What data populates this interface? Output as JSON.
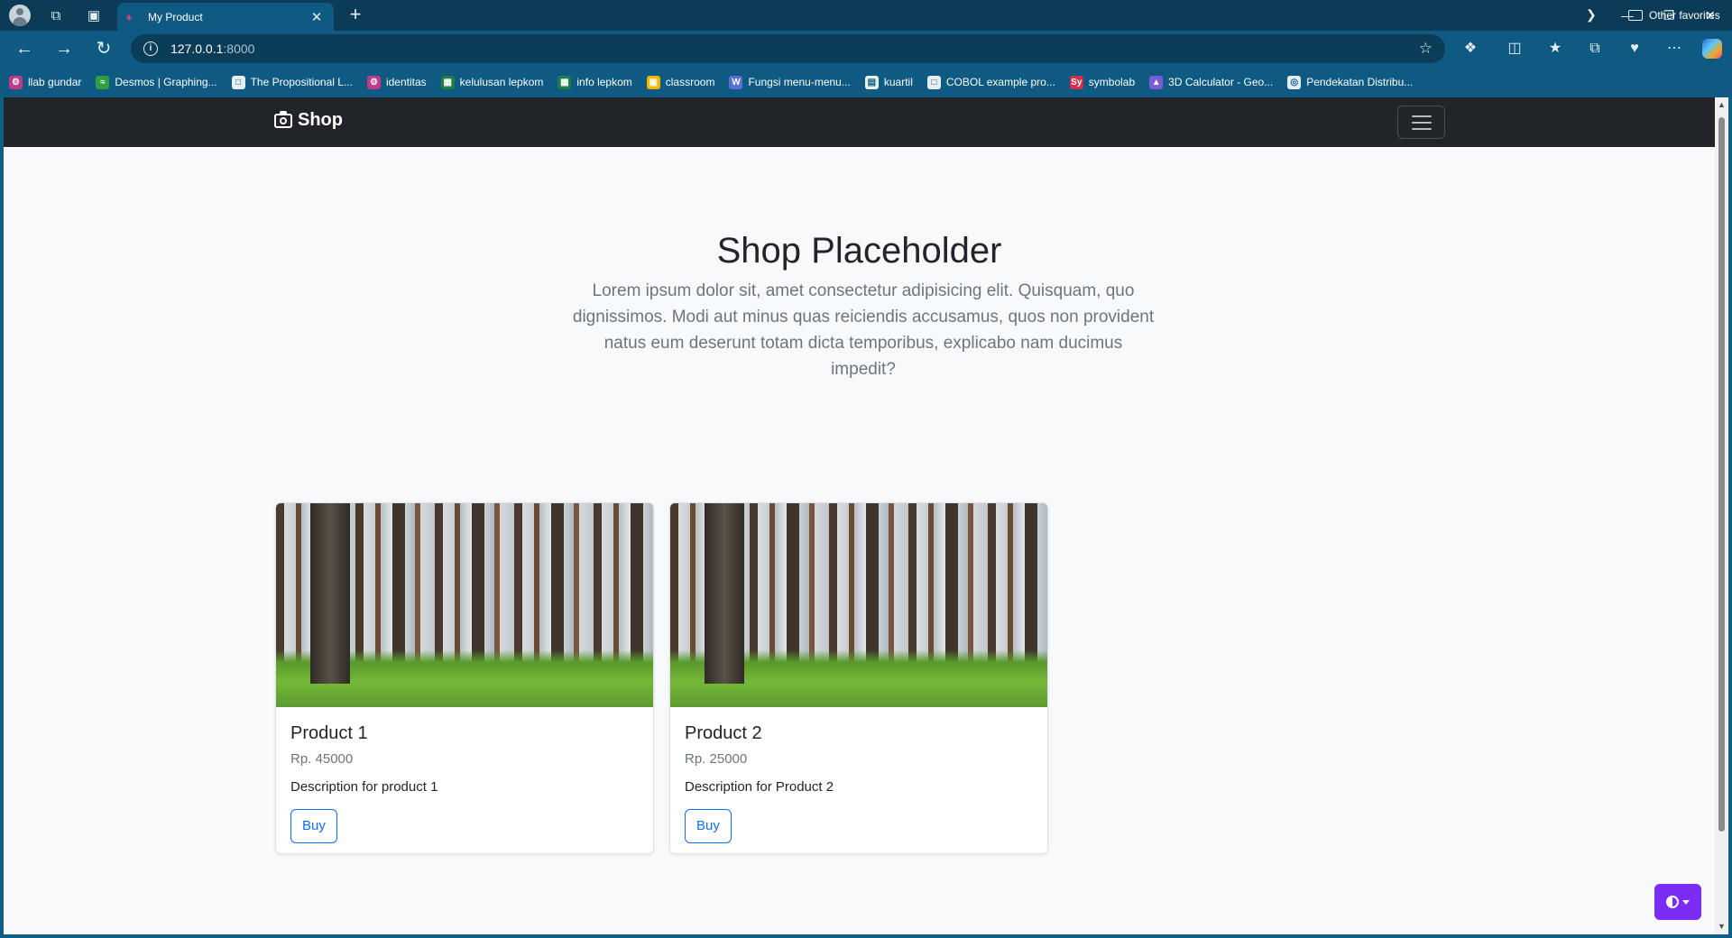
{
  "browser": {
    "tab_title": "My Product",
    "new_tab_symbol": "+",
    "address": {
      "host": "127.0.0.1",
      "port": ":8000"
    },
    "bookmarks": [
      {
        "label": "llab gundar",
        "icon": "gear-icon",
        "color": "#c0398d"
      },
      {
        "label": "Desmos | Graphing...",
        "icon": "desmos-icon",
        "color": "#2f9e44"
      },
      {
        "label": "The Propositional L...",
        "icon": "page-icon",
        "color": "#e6eef4"
      },
      {
        "label": "identitas",
        "icon": "gear-icon",
        "color": "#c0398d"
      },
      {
        "label": "kelulusan lepkom",
        "icon": "sheet-icon",
        "color": "#1e7e45"
      },
      {
        "label": "info lepkom",
        "icon": "sheet-icon",
        "color": "#1e7e45"
      },
      {
        "label": "classroom",
        "icon": "classroom-icon",
        "color": "#f4b400"
      },
      {
        "label": "Fungsi menu-menu...",
        "icon": "wordpress-icon",
        "color": "#5a6fd6"
      },
      {
        "label": "kuartil",
        "icon": "doc-icon",
        "color": "#e8f0e8"
      },
      {
        "label": "COBOL example pro...",
        "icon": "page-icon",
        "color": "#e6eef4"
      },
      {
        "label": "symbolab",
        "icon": "symbolab-icon",
        "color": "#d62d4a"
      },
      {
        "label": "3D Calculator - Geo...",
        "icon": "geogebra-icon",
        "color": "#7a5cd6"
      },
      {
        "label": "Pendekatan Distribu...",
        "icon": "globe-icon",
        "color": "#e6eef4"
      }
    ],
    "other_favorites": "Other favorites"
  },
  "navbar": {
    "brand": "Shop",
    "brand_icon": "camera-icon"
  },
  "hero": {
    "title": "Shop Placeholder",
    "text": "Lorem ipsum dolor sit, amet consectetur adipisicing elit. Quisquam, quo dignissimos. Modi aut minus quas reiciendis accusamus, quos non provident natus eum deserunt totam dicta temporibus, explicabo nam ducimus impedit?"
  },
  "products": [
    {
      "name": "Product 1",
      "price": "Rp. 45000",
      "description": "Description for product 1",
      "button": "Buy",
      "image": "forest-image"
    },
    {
      "name": "Product 2",
      "price": "Rp. 25000",
      "description": "Description for Product 2",
      "button": "Buy",
      "image": "forest-image"
    }
  ],
  "colors": {
    "chrome": "#0f5a82",
    "navbar": "#212529",
    "accent": "#0d6efd",
    "theme_button": "#7a2cf5"
  }
}
